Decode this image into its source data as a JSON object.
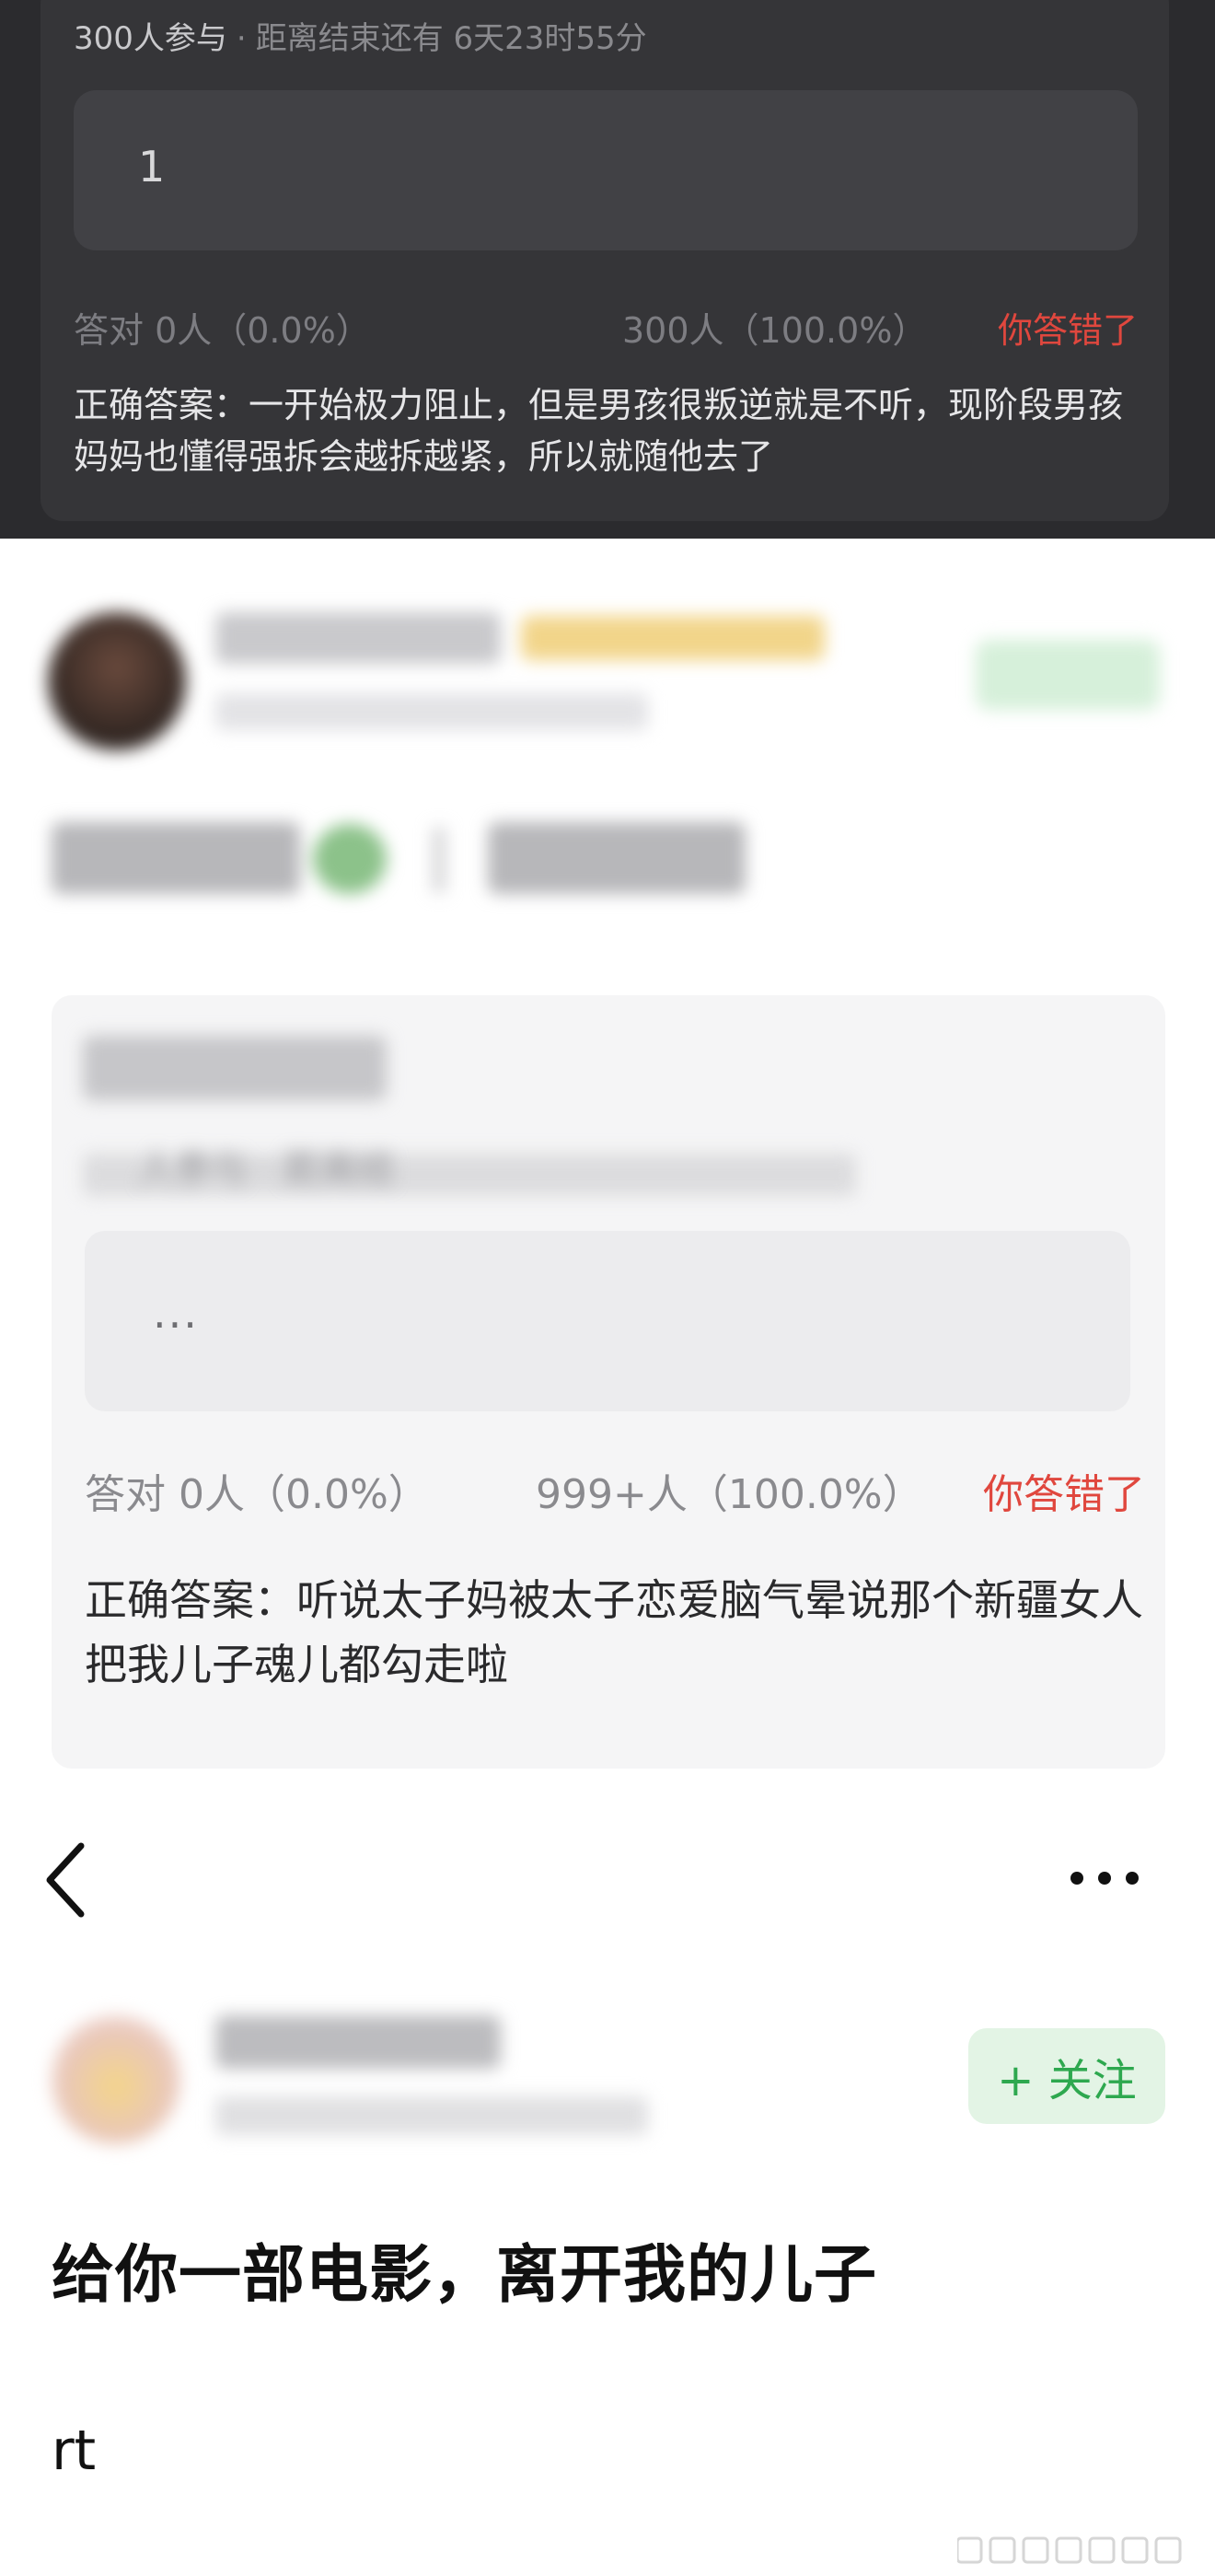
{
  "section1": {
    "participants": "300人参与",
    "separator": "·",
    "countdown": "距离结束还有 6天23时55分",
    "answer_value": "1",
    "correct_stat": "答对  0人（0.0%）",
    "wrong_stat": "300人（100.0%）",
    "you_wrong": "你答错了",
    "explanation": "正确答案：一开始极力阻止，但是男孩很叛逆就是不听，现阶段男孩妈妈也懂得强拆会越拆越紧，所以就随他去了"
  },
  "section2": {
    "meta_partial": "人参与 · 距离结",
    "answer_value": "...",
    "correct_stat": "答对  0人（0.0%）",
    "wrong_stat": "999+人（100.0%）",
    "you_wrong": "你答错了",
    "explanation": "正确答案：听说太子妈被太子恋爱脑气晕说那个新疆女人把我儿子魂儿都勾走啦"
  },
  "section3": {
    "follow_label": "+ 关注",
    "headline": "给你一部电影，离开我的儿子",
    "body": "rt"
  },
  "icons": [
    "back-chevron-icon",
    "more-dots-icon",
    "watermark-logo-icon"
  ],
  "colors": {
    "dark_bg": "#2b2b2e",
    "error_red": "#e0473e",
    "follow_green": "#2ea84f",
    "follow_bg": "#e3f4e5"
  }
}
